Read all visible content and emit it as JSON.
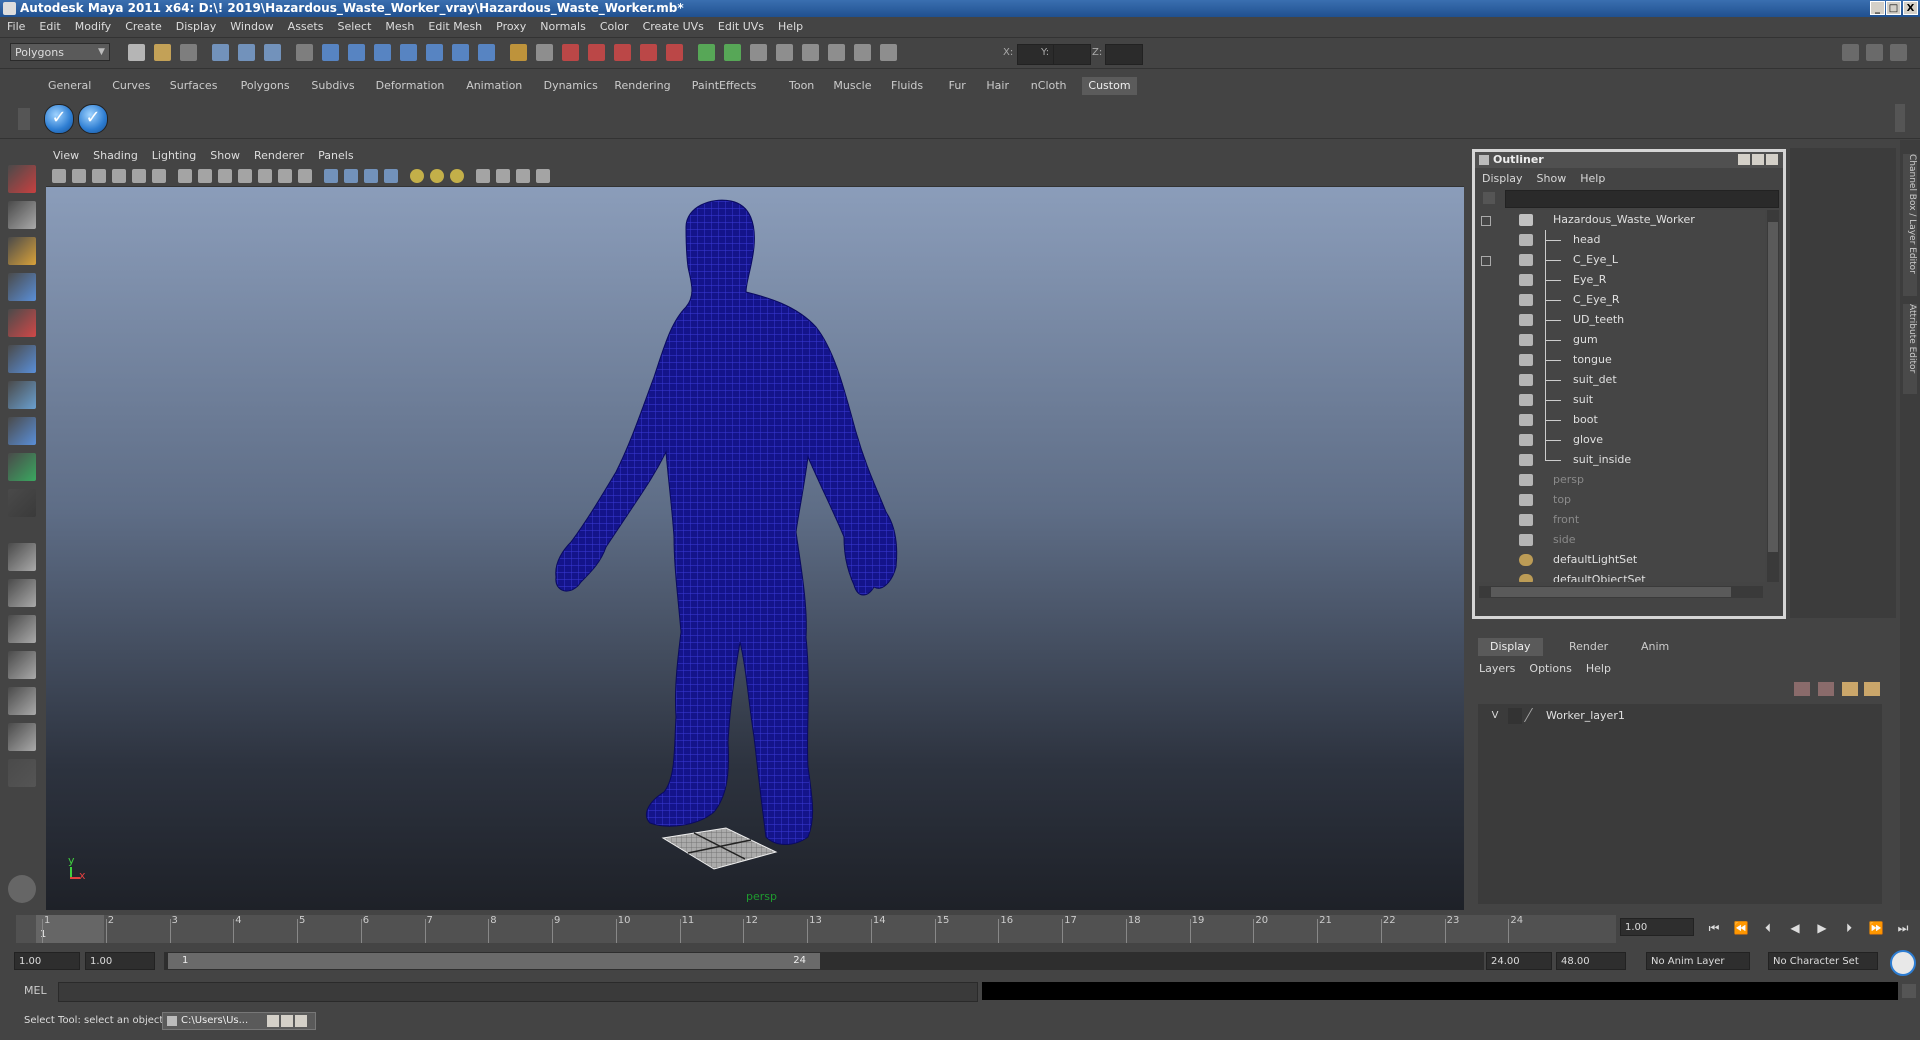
{
  "window": {
    "title": "Autodesk Maya 2011 x64: D:\\! 2019\\Hazardous_Waste_Worker_vray\\Hazardous_Waste_Worker.mb*",
    "min": "_",
    "max": "□",
    "close": "X"
  },
  "menubar": [
    "File",
    "Edit",
    "Modify",
    "Create",
    "Display",
    "Window",
    "Assets",
    "Select",
    "Mesh",
    "Edit Mesh",
    "Proxy",
    "Normals",
    "Color",
    "Create UVs",
    "Edit UVs",
    "Help"
  ],
  "toolbar": {
    "mode": "Polygons",
    "x_label": "X:",
    "y_label": "Y:",
    "z_label": "Z:"
  },
  "shelf": {
    "tabs": [
      "General",
      "Curves",
      "Surfaces",
      "Polygons",
      "Subdivs",
      "Deformation",
      "Animation",
      "Dynamics",
      "Rendering",
      "PaintEffects",
      "Toon",
      "Muscle",
      "Fluids",
      "Fur",
      "Hair",
      "nCloth",
      "Custom"
    ],
    "active_tab": "Custom",
    "buttons": [
      "check-icon",
      "check-icon"
    ]
  },
  "viewport": {
    "menu": [
      "View",
      "Shading",
      "Lighting",
      "Show",
      "Renderer",
      "Panels"
    ],
    "camera_label": "persp",
    "axis_y": "y",
    "axis_x": "x",
    "wire_color": "#0a0a8c"
  },
  "outliner": {
    "title": "Outliner",
    "menu": [
      "Display",
      "Show",
      "Help"
    ],
    "items": [
      {
        "label": "Hazardous_Waste_Worker",
        "type": "root",
        "dimmed": false
      },
      {
        "label": "head",
        "type": "mesh",
        "dimmed": false
      },
      {
        "label": "C_Eye_L",
        "type": "mesh",
        "dimmed": false
      },
      {
        "label": "Eye_R",
        "type": "mesh",
        "dimmed": false
      },
      {
        "label": "C_Eye_R",
        "type": "mesh",
        "dimmed": false
      },
      {
        "label": "UD_teeth",
        "type": "mesh",
        "dimmed": false
      },
      {
        "label": "gum",
        "type": "mesh",
        "dimmed": false
      },
      {
        "label": "tongue",
        "type": "mesh",
        "dimmed": false
      },
      {
        "label": "suit_det",
        "type": "mesh",
        "dimmed": false
      },
      {
        "label": "suit",
        "type": "mesh",
        "dimmed": false
      },
      {
        "label": "boot",
        "type": "mesh",
        "dimmed": false
      },
      {
        "label": "glove",
        "type": "mesh",
        "dimmed": false
      },
      {
        "label": "suit_inside",
        "type": "mesh",
        "dimmed": false
      },
      {
        "label": "persp",
        "type": "camera",
        "dimmed": true
      },
      {
        "label": "top",
        "type": "camera",
        "dimmed": true
      },
      {
        "label": "front",
        "type": "camera",
        "dimmed": true
      },
      {
        "label": "side",
        "type": "camera",
        "dimmed": true
      },
      {
        "label": "defaultLightSet",
        "type": "set",
        "dimmed": false
      },
      {
        "label": "defaultObjectSet",
        "type": "set",
        "dimmed": false
      }
    ]
  },
  "side_tabs": {
    "channel_box": "Channel Box / Layer Editor",
    "attribute_editor": "Attribute Editor"
  },
  "layer_editor": {
    "tabs": [
      "Display",
      "Render",
      "Anim"
    ],
    "active_tab": "Display",
    "menu": [
      "Layers",
      "Options",
      "Help"
    ],
    "layers": [
      {
        "visible": "V",
        "name": "Worker_layer1"
      }
    ]
  },
  "timeline": {
    "ticks": [
      "1",
      "2",
      "3",
      "4",
      "5",
      "6",
      "7",
      "8",
      "9",
      "10",
      "11",
      "12",
      "13",
      "14",
      "15",
      "16",
      "17",
      "18",
      "19",
      "20",
      "21",
      "22",
      "23",
      "24"
    ],
    "current_frame_marker": "1",
    "current_time": "1.00"
  },
  "range": {
    "start": "1.00",
    "playback_start": "1.00",
    "slider_start": "1",
    "slider_end": "24",
    "playback_end": "24.00",
    "end": "48.00",
    "anim_layer": "No Anim Layer",
    "character_set": "No Character Set"
  },
  "command_line": {
    "label": "MEL"
  },
  "help_line": {
    "text": "Select Tool: select an object",
    "taskbar_item": "C:\\Users\\Us..."
  }
}
